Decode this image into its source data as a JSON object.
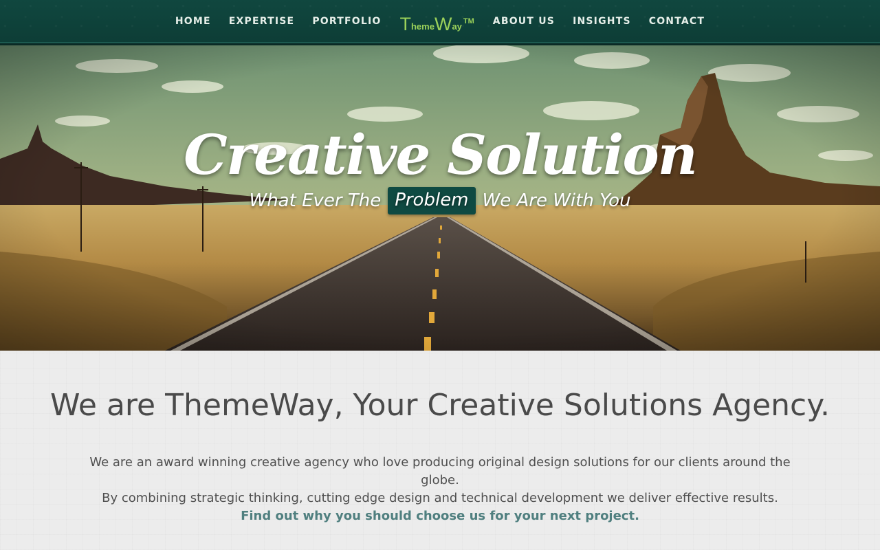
{
  "nav": {
    "left": [
      "HOME",
      "EXPERTISE",
      "PORTFOLIO"
    ],
    "right": [
      "ABOUT US",
      "INSIGHTS",
      "CONTACT"
    ],
    "logo": {
      "t": "T",
      "heme": "heme",
      "w": "W",
      "ay": "ay",
      "tm": "TM"
    }
  },
  "hero": {
    "title": "Creative Solution",
    "tagline_before": "What Ever The",
    "tagline_highlight": "Problem",
    "tagline_after": "We Are With You"
  },
  "about": {
    "heading": "We are ThemeWay, Your Creative Solutions Agency.",
    "line1": "We are an award winning creative agency who love producing original design solutions for our clients around the globe.",
    "line2": "By combining strategic thinking, cutting edge design and technical development we deliver effective results.",
    "cta": "Find out why you should choose us for your next project."
  },
  "colors": {
    "nav_bg": "#10473f",
    "logo_green": "#9bd15a",
    "highlight_bg": "#0f4a42",
    "cta_link": "#4f7f7f",
    "heading_text": "#4a4a4a"
  }
}
